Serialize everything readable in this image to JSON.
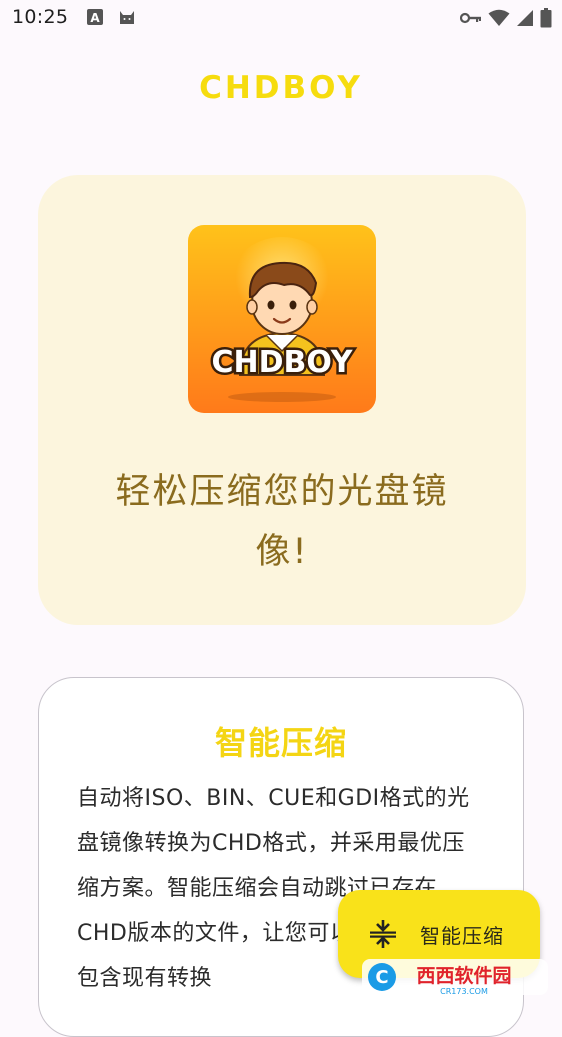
{
  "status_bar": {
    "time": "10:25",
    "left_icons": [
      "text-input-icon",
      "android-cat-icon"
    ],
    "right_icons": [
      "vpn-key-icon",
      "wifi-icon",
      "signal-icon",
      "battery-icon"
    ]
  },
  "app": {
    "title": "CHDBOY"
  },
  "hero": {
    "logo_text": "CHDBOY",
    "tagline": "轻松压缩您的光盘镜像!"
  },
  "feature": {
    "title": "智能压缩",
    "description": "自动将ISO、BIN、CUE和GDI格式的光盘镜像转换为CHD格式，并采用最优压缩方案。智能压缩会自动跳过已存在CHD版本的文件，让您可以安全地使用包含现有转换"
  },
  "fab": {
    "label": "智能压缩",
    "icon": "compress-icon"
  },
  "watermark": {
    "text": "西西软件园",
    "sub": "CR173.COM"
  },
  "colors": {
    "accent_yellow": "#f6dc0e",
    "hero_bg": "#fcf5dd",
    "hero_text": "#8a6b1e",
    "fab_bg": "#f9e21a"
  }
}
